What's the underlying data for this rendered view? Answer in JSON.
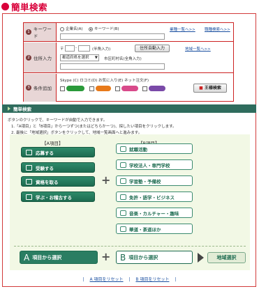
{
  "page": {
    "title": "簡単検索"
  },
  "form": {
    "keyword": {
      "label": "キーワード",
      "num": "1",
      "opt_company": "企業名(A)",
      "opt_keyword": "キーワード(B)",
      "link_list1": "業種一覧へ>>",
      "link_list2": "職種検索へ>>"
    },
    "address": {
      "label": "住所入力",
      "num": "2",
      "postal_mark": "〒",
      "postal_note": "(半角入力)",
      "auto_button": "住所自動入力",
      "map_link": "地域一覧へ>>",
      "pref_value": "都道府県を選択",
      "city_note": "市区町村名(全角入力)"
    },
    "conditions": {
      "label": "条件追加",
      "num": "3",
      "checks_text": "Skype (C) ロコミ(D) お気に入り(E) ネット注文(F)",
      "search_button": "王様検索"
    }
  },
  "section": {
    "title": "簡単検索",
    "intro": "ボタンのクリックで、キーワードが自動で入力できます。",
    "step1": "1.「A項目」と「B項目」から一つずつ(またはどちらかーつ)、探したい項目をクリックします。",
    "step2": "2. 最後に「地域選択」ボタンをクリックして、地域一覧画面へと進みます。"
  },
  "columns": {
    "a_head": "【A項目】",
    "b_head": "【B項目】"
  },
  "a_items": [
    "応募する",
    "受験する",
    "資格を取る",
    "学ぶ・お稽古する"
  ],
  "b_items": [
    "就職活動",
    "学校法人・専門学校",
    "学習塾・予備校",
    "免許・語学・ビジネス",
    "音楽・カルチャー・趣味",
    "華道・茶道ほか"
  ],
  "bottom": {
    "a_letter": "A",
    "a_label": "項目から選択",
    "b_letter": "B",
    "b_label": "項目から選択",
    "region_button": "地域選択"
  },
  "footer": {
    "sep": "|",
    "reset_a": "A 項目をリセット",
    "reset_b": "B 項目をリセット"
  }
}
